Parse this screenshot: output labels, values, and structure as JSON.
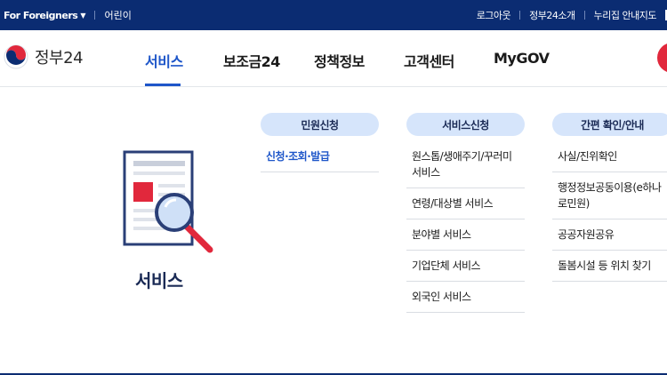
{
  "topbar": {
    "for_foreigners": "For Foreigners",
    "kids": "어린이",
    "login": "로그아웃",
    "about": "정부24소개",
    "sitemap": "누리집 안내지도"
  },
  "header": {
    "logo_text": "정부24",
    "nav": [
      {
        "label": "서비스"
      },
      {
        "label": "보조금24"
      },
      {
        "label": "정책정보"
      },
      {
        "label": "고객센터"
      },
      {
        "label": "MyGOV"
      }
    ]
  },
  "panel": {
    "title": "서비스",
    "columns": [
      {
        "header": "민원신청",
        "items": [
          "신청·조회·발급"
        ]
      },
      {
        "header": "서비스신청",
        "items": [
          "원스톱/생애주기/꾸러미 서비스",
          "연령/대상별 서비스",
          "분야별 서비스",
          "기업단체 서비스",
          "외국인 서비스"
        ]
      },
      {
        "header": "간편 확인/안내",
        "items": [
          "사실/진위확인",
          "행정정보공동이용(e하나로민원)",
          "공공자원공유",
          "돌봄시설 등 위치 찾기"
        ]
      }
    ]
  },
  "colors": {
    "navy": "#0b2c72",
    "accent_blue": "#1e56c9",
    "pill_bg": "#d6e5fb",
    "red": "#e1283c"
  }
}
